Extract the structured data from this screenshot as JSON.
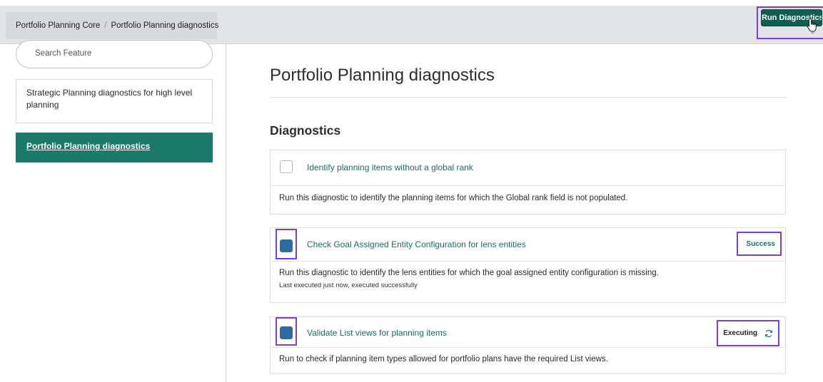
{
  "breadcrumb": {
    "parent": "Portfolio Planning Core",
    "separator": "/",
    "current": "Portfolio Planning diagnostics"
  },
  "toolbar": {
    "run_label": "Run Diagnostics"
  },
  "sidebar": {
    "search_placeholder": "Search Feature",
    "items": [
      {
        "label": "Strategic Planning diagnostics for high level planning",
        "active": false
      },
      {
        "label": "Portfolio Planning diagnostics",
        "active": true
      }
    ]
  },
  "main": {
    "title": "Portfolio Planning diagnostics",
    "section_title": "Diagnostics",
    "diagnostics": [
      {
        "name": "Identify planning items without a global rank",
        "description": "Run this diagnostic to identify the planning items for which the Global rank field is not populated.",
        "checked": false
      },
      {
        "name": "Check Goal Assigned Entity Configuration for lens entities",
        "description": "Run this diagnostic to identify the lens entities for which the goal assigned entity configuration is missing.",
        "last_run": "Last executed just now, executed successfully",
        "status": "Success",
        "checked": true
      },
      {
        "name": "Validate List views for planning items",
        "description": "Run to check if planning item types allowed for portfolio plans have the required List views.",
        "status": "Executing",
        "status_icon": "refresh-icon",
        "checked": true
      }
    ]
  },
  "colors": {
    "accent": "#1c7a6a",
    "button": "#0f5e52",
    "highlight": "#7a3fe0",
    "checkbox_checked": "#2e6aa0"
  }
}
